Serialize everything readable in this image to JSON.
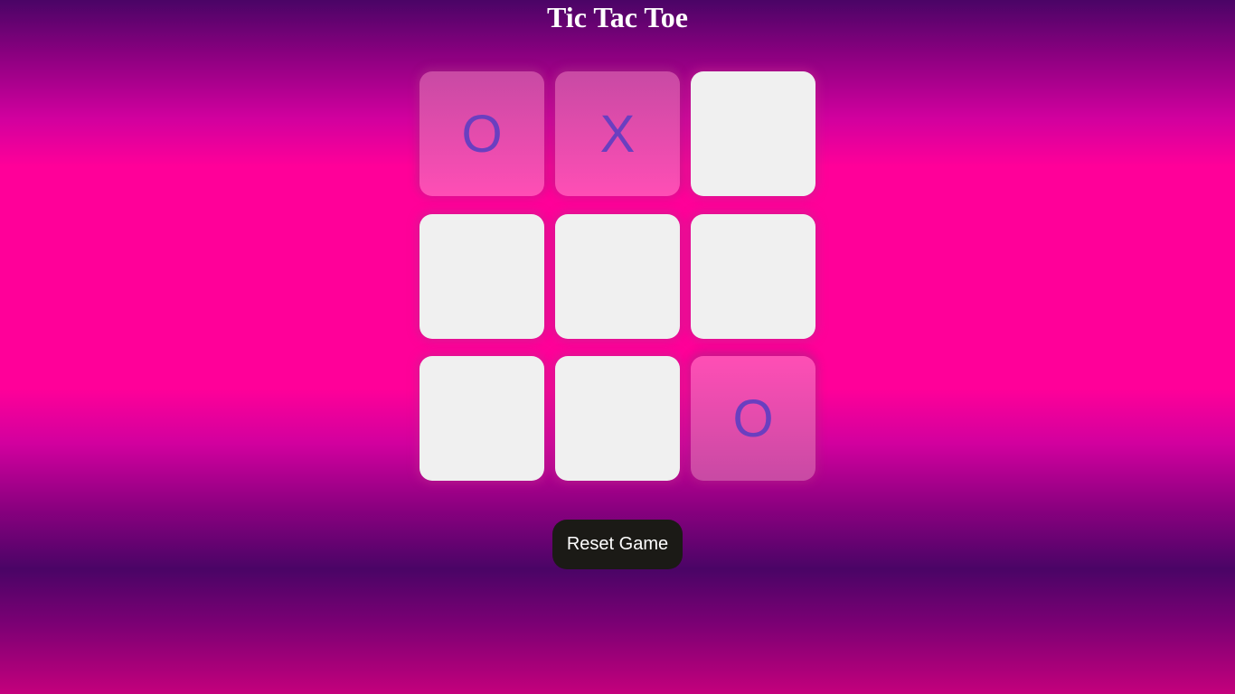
{
  "title": "Tic Tac Toe",
  "board": {
    "cells": [
      "O",
      "X",
      "",
      "",
      "",
      "",
      "",
      "",
      "O"
    ]
  },
  "reset_label": "Reset Game",
  "colors": {
    "background_pink": "#ff0099",
    "background_purple": "#4a0466",
    "empty_cell": "#f0f0f0",
    "filled_cell": "#ff4eb5",
    "mark": "#6a3fc0",
    "button": "#1b1a16"
  }
}
